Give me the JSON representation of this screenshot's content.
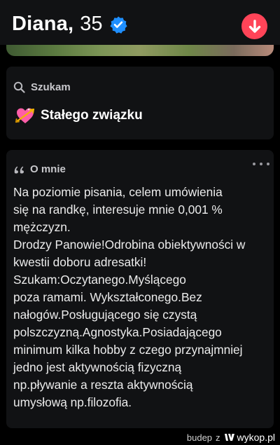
{
  "header": {
    "name": "Diana,",
    "age": "35",
    "verified_icon": "verified-check-icon",
    "down_button_icon": "arrow-down-icon",
    "accent_color": "#ff4458",
    "verified_color": "#1f8fff"
  },
  "looking_for": {
    "icon": "search-icon",
    "label": "Szukam",
    "value_icon": "heart-with-arrow-icon",
    "value": "Stałego związku"
  },
  "about": {
    "icon": "quote-icon",
    "label": "O mnie",
    "menu_icon": "more-dots-icon",
    "text": "Na poziomie pisania, celem umówienia\nsię na randkę, interesuje mnie 0,001 %\nmężczyzn.\nDrodzy Panowie!Odrobina obiektywności w\nkwestii doboru adresatki!\nSzukam:Oczytanego.Myślącego\npoza ramami. Wykształconego.Bez\nnałogów.Posługującego się czystą\npolszczyzną.Agnostyka.Posiadającego\nminimum kilka hobby z czego przynajmniej\njedno jest aktywnością fizyczną\nnp.pływanie a reszta aktywnością\numysłową np.filozofia."
  },
  "watermark": {
    "user": "budep",
    "z": "z",
    "site": "wykop.pl",
    "logo_icon": "wykop-logo-icon"
  }
}
